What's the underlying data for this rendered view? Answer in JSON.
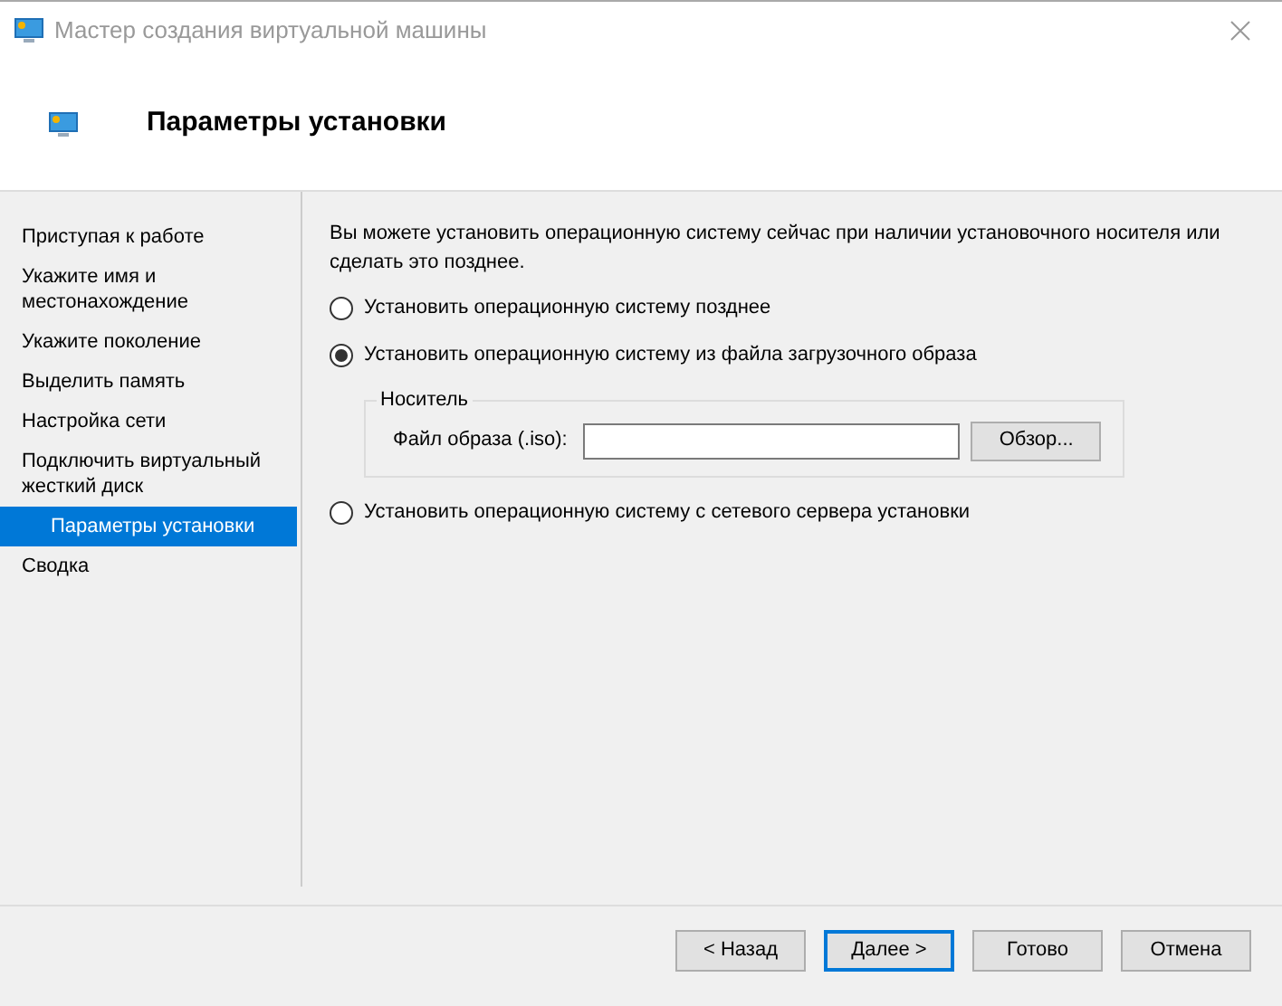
{
  "window": {
    "title": "Мастер создания виртуальной машины"
  },
  "header": {
    "title": "Параметры установки"
  },
  "sidebar": {
    "items": [
      {
        "label": "Приступая к работе",
        "selected": false
      },
      {
        "label": "Укажите имя и местонахождение",
        "selected": false
      },
      {
        "label": "Укажите поколение",
        "selected": false
      },
      {
        "label": "Выделить память",
        "selected": false
      },
      {
        "label": "Настройка сети",
        "selected": false
      },
      {
        "label": "Подключить виртуальный жесткий диск",
        "selected": false
      },
      {
        "label": "Параметры установки",
        "selected": true
      },
      {
        "label": "Сводка",
        "selected": false
      }
    ]
  },
  "content": {
    "description": "Вы можете установить операционную систему сейчас при наличии установочного носителя или сделать это позднее.",
    "options": [
      {
        "label": "Установить операционную систему позднее",
        "selected": false
      },
      {
        "label": "Установить операционную систему из файла загрузочного образа",
        "selected": true,
        "group": {
          "title": "Носитель",
          "field_label": "Файл образа (.iso):",
          "browse_button": "Обзор..."
        }
      },
      {
        "label": "Установить операционную систему с сетевого сервера установки",
        "selected": false
      }
    ]
  },
  "buttons": [
    {
      "label": "< Назад",
      "default": false
    },
    {
      "label": "Далее >",
      "default": true
    },
    {
      "label": "Готово",
      "default": false
    },
    {
      "label": "Отмена",
      "default": false
    }
  ]
}
